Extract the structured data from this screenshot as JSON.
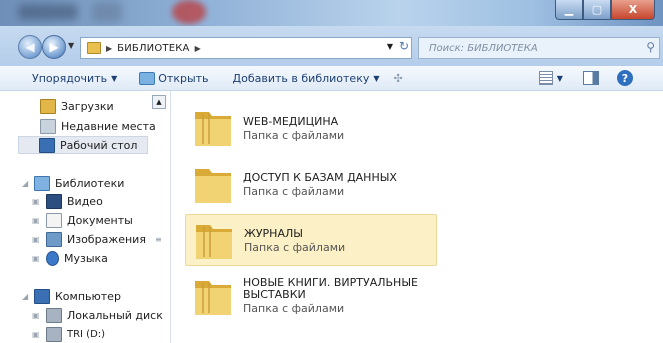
{
  "window": {
    "min_glyph": "▁",
    "max_glyph": "▢",
    "close_glyph": "X"
  },
  "address": {
    "path": "БИБЛИОТЕКА",
    "search_placeholder": "Поиск: БИБЛИОТЕКА"
  },
  "toolbar": {
    "organize": "Упорядочить",
    "open": "Открыть",
    "add_to_library": "Добавить в библиотеку"
  },
  "nav": {
    "favorites": [
      {
        "label": "Загрузки",
        "icon": "downloads-icon"
      },
      {
        "label": "Недавние места",
        "icon": "recent-places-icon"
      },
      {
        "label": "Рабочий стол",
        "icon": "desktop-icon",
        "selected": true
      }
    ],
    "libraries": {
      "label": "Библиотеки",
      "items": [
        {
          "label": "Видео",
          "icon": "video-icon"
        },
        {
          "label": "Документы",
          "icon": "documents-icon"
        },
        {
          "label": "Изображения",
          "icon": "images-icon"
        },
        {
          "label": "Музыка",
          "icon": "music-icon"
        }
      ]
    },
    "computer": {
      "label": "Компьютер",
      "items": [
        {
          "label": "Локальный диск",
          "icon": "hard-drive-icon"
        },
        {
          "label": "TRI (D:)",
          "icon": "drive-icon"
        }
      ]
    }
  },
  "folders": [
    {
      "name_line1": "WEB-МЕДИЦИНА",
      "name_line2": "",
      "type": "Папка с файлами"
    },
    {
      "name_line1": "ДОСТУП К БАЗАМ ДАННЫХ",
      "name_line2": "",
      "type": "Папка с файлами"
    },
    {
      "name_line1": "ЖУРНАЛЫ",
      "name_line2": "",
      "type": "Папка с файлами",
      "highlighted": true
    },
    {
      "name_line1": "НОВЫЕ КНИГИ. ВИРТУАЛЬНЫЕ",
      "name_line2": "ВЫСТАВКИ",
      "type": "Папка с файлами"
    }
  ],
  "colors": {
    "accent": "#1e3f74",
    "highlight": "#fcf1c6",
    "folder": "#e7c04f"
  }
}
